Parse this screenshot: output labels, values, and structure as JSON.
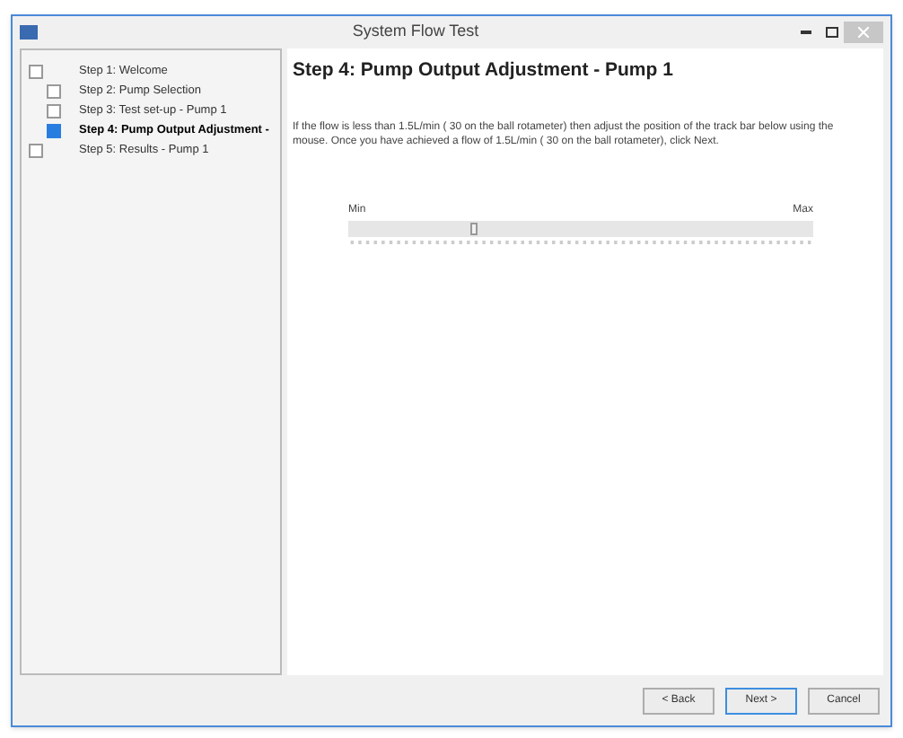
{
  "window": {
    "title": "System Flow Test"
  },
  "steps": [
    {
      "label": "Step 1: Welcome",
      "selected": false
    },
    {
      "label": "Step 2: Pump Selection",
      "selected": false
    },
    {
      "label": "Step 3: Test set-up - Pump 1",
      "selected": false
    },
    {
      "label": "Step 4: Pump Output Adjustment -",
      "selected": true
    },
    {
      "label": "Step 5: Results - Pump 1",
      "selected": false
    }
  ],
  "heading": "Step 4: Pump Output Adjustment - Pump 1",
  "instructions": "If the flow is less than 1.5L/min ( 30 on the ball rotameter) then adjust the position of the track bar below using the mouse. Once you have achieved a flow of 1.5L/min ( 30 on the ball rotameter), click Next.",
  "slider": {
    "min_label": "Min",
    "max_label": "Max",
    "level": 0.27
  },
  "buttons": [
    {
      "label": "< Back",
      "selected": false
    },
    {
      "label": "Next >",
      "selected": true
    },
    {
      "label": "Cancel",
      "selected": false
    }
  ]
}
